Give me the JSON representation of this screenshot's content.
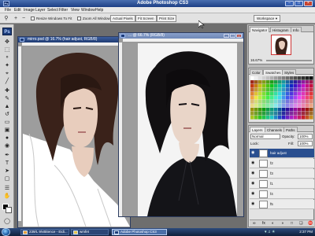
{
  "app": {
    "title": "Adobe Photoshop CS3",
    "badge": "Ps"
  },
  "window_controls": {
    "minimize": "–",
    "maximize": "□",
    "close": "×"
  },
  "menu": [
    "File",
    "Edit",
    "Image",
    "Layer",
    "Select",
    "Filter",
    "View",
    "Window",
    "Help"
  ],
  "options_bar": {
    "resize_windows_label": "Resize Windows To Fit",
    "zoom_all_windows_label": "Zoom All Windows",
    "actual_pixels": "Actual Pixels",
    "fit_screen": "Fit Screen",
    "print_size": "Print Size",
    "workspace": "Workspace"
  },
  "documents": [
    {
      "title": "mirro.psd @ 16.7% (hair adjust, RGB/8)",
      "active": true
    },
    {
      "title": "... @ 66.7% (RGB/8)",
      "active": false
    }
  ],
  "panels": {
    "navigator_tabs": [
      "Navigator",
      "Histogram",
      "Info"
    ],
    "navigator_zoom": "16.67%",
    "color_tabs": [
      "Color",
      "Swatches",
      "Styles"
    ],
    "layers_tabs": [
      "Layers",
      "Channels",
      "Paths"
    ],
    "blend_mode": "Normal",
    "opacity_label": "Opacity:",
    "opacity_value": "100%",
    "lock_label": "Lock:",
    "fill_label": "Fill:",
    "fill_value": "100%",
    "layers": [
      {
        "name": "hair adjust",
        "selected": true
      },
      {
        "name": "f2",
        "selected": false
      },
      {
        "name": "f3",
        "selected": false
      },
      {
        "name": "f1",
        "selected": false
      },
      {
        "name": "f4",
        "selected": false
      },
      {
        "name": "f5",
        "selected": false
      }
    ]
  },
  "taskbar": {
    "tasks": [
      {
        "label": "239/L 9/vBitence - Eidi...",
        "active": false
      },
      {
        "label": "wmfet",
        "active": false
      },
      {
        "label": "Adobe Photoshop CS3",
        "active": true
      }
    ],
    "clock": "2:37 PM"
  },
  "colors": {
    "titlebar": "#1d3f85",
    "selected_layer": "#2a4f8f",
    "canvas_gray": "#9a9a9a"
  }
}
